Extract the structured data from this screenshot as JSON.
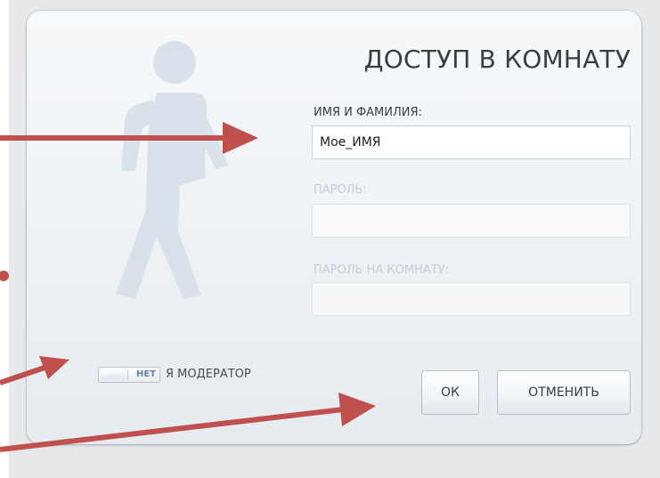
{
  "dialog": {
    "title": "ДОСТУП В КОМНАТУ",
    "name_label": "ИМЯ И ФАМИЛИЯ:",
    "name_value": "Мое_ИМЯ",
    "password_label": "ПАРОЛЬ:",
    "password_value": "",
    "room_password_label": "ПАРОЛЬ НА КОМНАТУ:",
    "room_password_value": "",
    "moderator_toggle_text": "НЕТ",
    "moderator_label": "Я МОДЕРАТОР",
    "ok_label": "ОК",
    "cancel_label": "ОТМЕНИТЬ"
  },
  "colors": {
    "arrow": "#c0504d",
    "dialog_bg": "#eef2f5",
    "figure": "#d9e2ea"
  }
}
